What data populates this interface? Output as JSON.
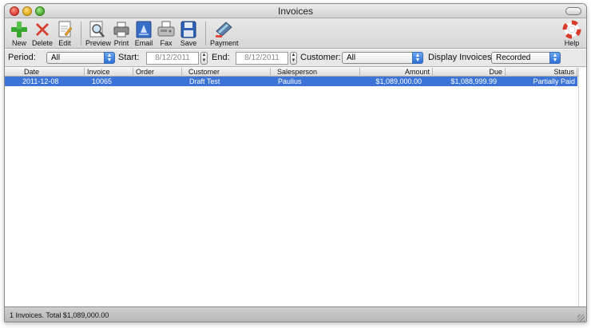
{
  "window": {
    "title": "Invoices"
  },
  "toolbar": {
    "new": "New",
    "delete": "Delete",
    "edit": "Edit",
    "preview": "Preview",
    "print": "Print",
    "email": "Email",
    "fax": "Fax",
    "save": "Save",
    "payment": "Payment",
    "help": "Help"
  },
  "filters": {
    "period_label": "Period:",
    "period_value": "All",
    "start_label": "Start:",
    "start_value": "8/12/2011",
    "end_label": "End:",
    "end_value": "8/12/2011",
    "customer_label": "Customer:",
    "customer_value": "All",
    "display_label": "Display Invoices:",
    "display_value": "Recorded"
  },
  "table": {
    "columns": [
      "Date",
      "Invoice",
      "Order",
      "Customer",
      "Salesperson",
      "Amount",
      "Due",
      "Status"
    ],
    "rows": [
      {
        "date": "2011-12-08",
        "invoice": "10065",
        "order": "",
        "customer": "Draft Test",
        "salesperson": "Paulius",
        "amount": "$1,089,000.00",
        "due": "$1,088,999.99",
        "status": "Partially Paid"
      }
    ]
  },
  "status": {
    "summary": "1 Invoices. Total $1,089,000.00"
  },
  "colors": {
    "selection": "#3b74d6",
    "accent_blue": "#2b6fd4"
  },
  "icons": [
    "plus-icon",
    "x-icon",
    "edit-document-icon",
    "preview-magnifier-icon",
    "printer-icon",
    "email-icon",
    "fax-icon",
    "floppy-disk-icon",
    "card-payment-icon",
    "lifebuoy-icon"
  ]
}
